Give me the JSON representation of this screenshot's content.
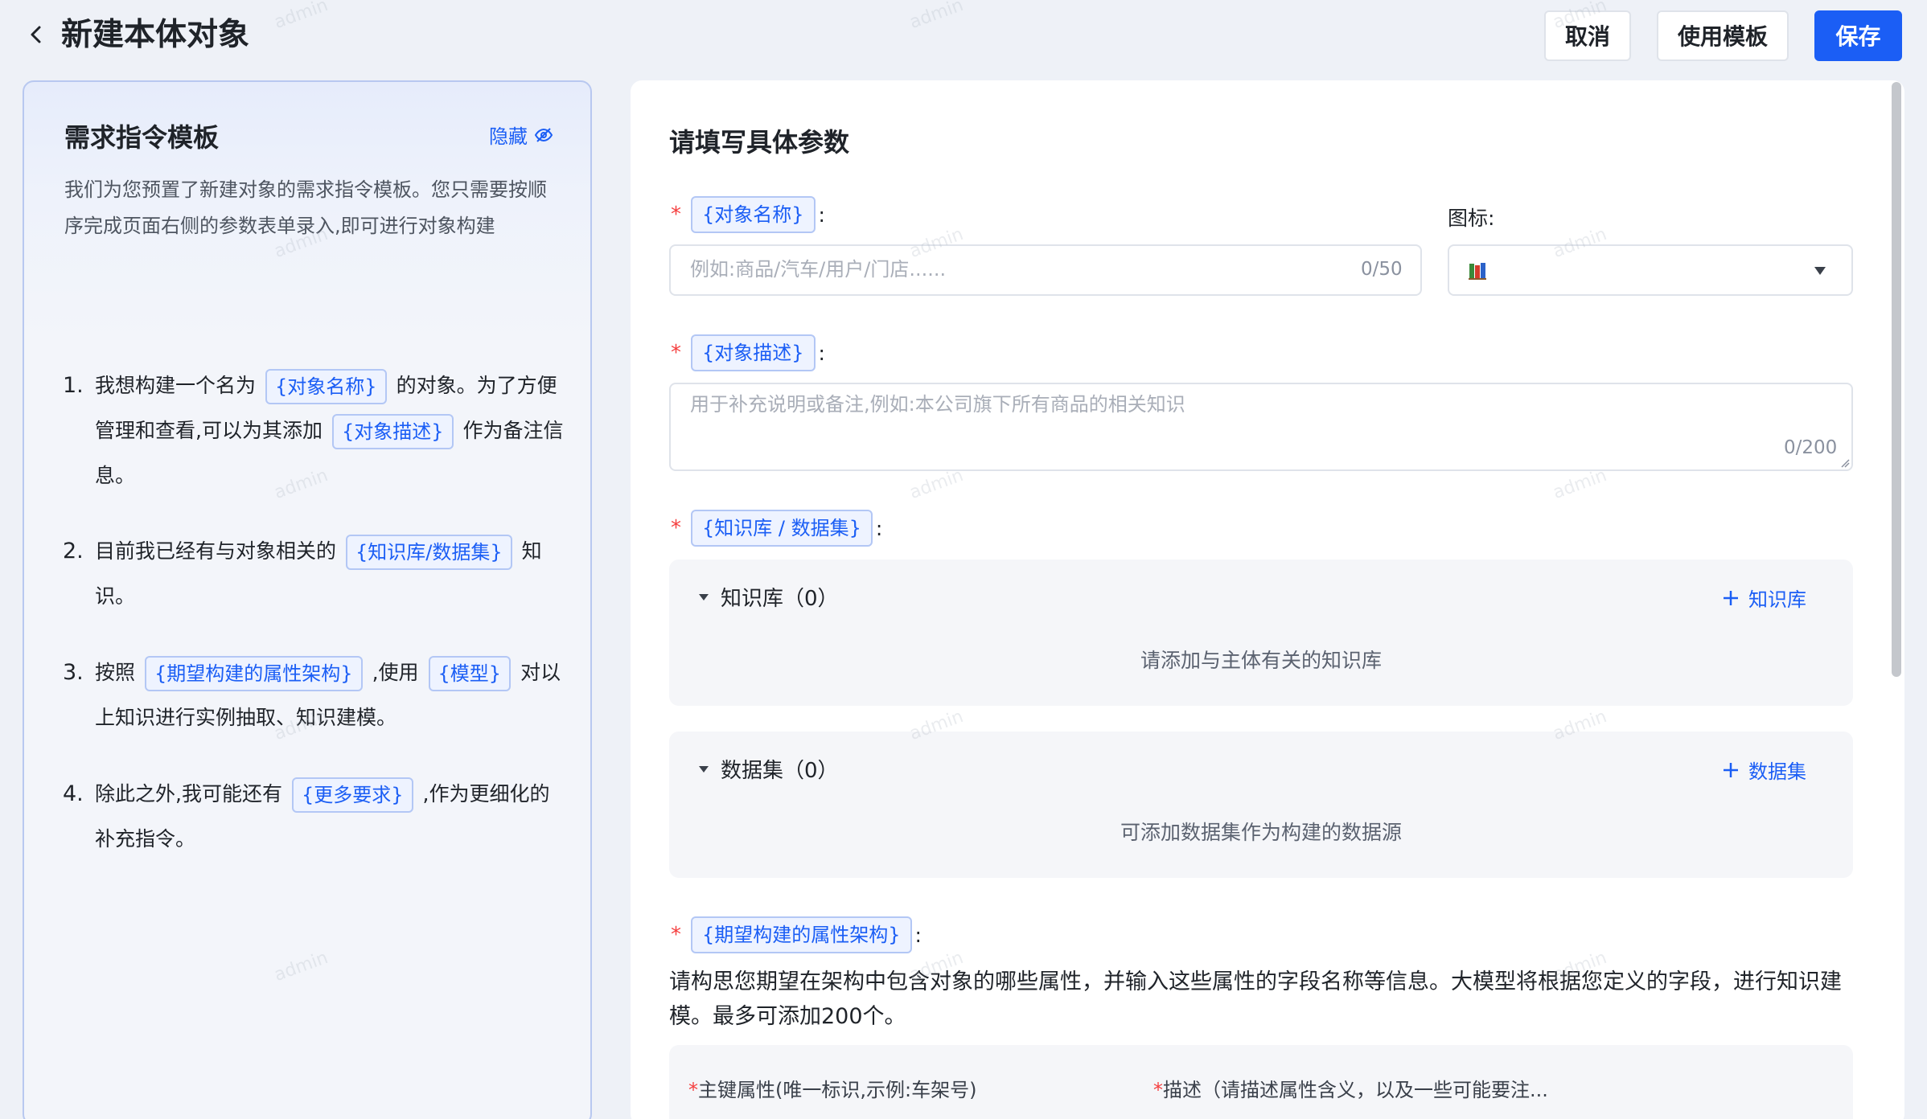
{
  "header": {
    "title": "新建本体对象",
    "cancel_label": "取消",
    "use_template_label": "使用模板",
    "save_label": "保存"
  },
  "guide": {
    "title": "需求指令模板",
    "hide_label": "隐藏",
    "intro": "我们为您预置了新建对象的需求指令模板。您只需要按顺序完成页面右侧的参数表单录入,即可进行对象构建",
    "steps": {
      "s1": {
        "num": "1.",
        "a": "我想构建一个名为",
        "chip1": "{对象名称}",
        "b": "的对象。为了方便管理和查看,可以为其添加",
        "chip2": "{对象描述}",
        "c": "作为备注信息。"
      },
      "s2": {
        "num": "2.",
        "a": "目前我已经有与对象相关的",
        "chip1": "{知识库/数据集}",
        "b": "知识。"
      },
      "s3": {
        "num": "3.",
        "a": "按照",
        "chip1": "{期望构建的属性架构}",
        "b": ",使用",
        "chip2": "{模型}",
        "c": "对以上知识进行实例抽取、知识建模。"
      },
      "s4": {
        "num": "4.",
        "a": "除此之外,我可能还有",
        "chip1": "{更多要求}",
        "b": ",作为更细化的补充指令。"
      }
    }
  },
  "form": {
    "title": "请填写具体参数",
    "name_label": "{对象名称}",
    "name_placeholder": "例如:商品/汽车/用户/门店......",
    "name_counter": "0/50",
    "icon_label": "图标:",
    "desc_label": "{对象描述}",
    "desc_placeholder": "用于补充说明或备注,例如:本公司旗下所有商品的相关知识",
    "desc_counter": "0/200",
    "source_label": "{知识库 / 数据集}",
    "kb": {
      "title": "知识库（0）",
      "add_label": "知识库",
      "empty": "请添加与主体有关的知识库"
    },
    "ds": {
      "title": "数据集（0）",
      "add_label": "数据集",
      "empty": "可添加数据集作为构建的数据源"
    },
    "schema_label": "{期望构建的属性架构}",
    "schema_desc": "请构思您期望在架构中包含对象的哪些属性，并输入这些属性的字段名称等信息。大模型将根据您定义的字段，进行知识建模。最多可添加200个。",
    "attr_primary_label": "主键属性(唯一标识,示例:车架号)",
    "attr_desc_label": "描述（请描述属性含义，以及一些可能要注..."
  },
  "required_mark": "*",
  "watermark": "admin",
  "colors": {
    "accent": "#1b5ef5",
    "required": "#f53f3f"
  },
  "icons": {
    "back": "chevron-left-icon",
    "hide": "eye-off-icon",
    "plus": "plus-icon",
    "caret": "caret-down-icon",
    "books": "books-icon"
  }
}
